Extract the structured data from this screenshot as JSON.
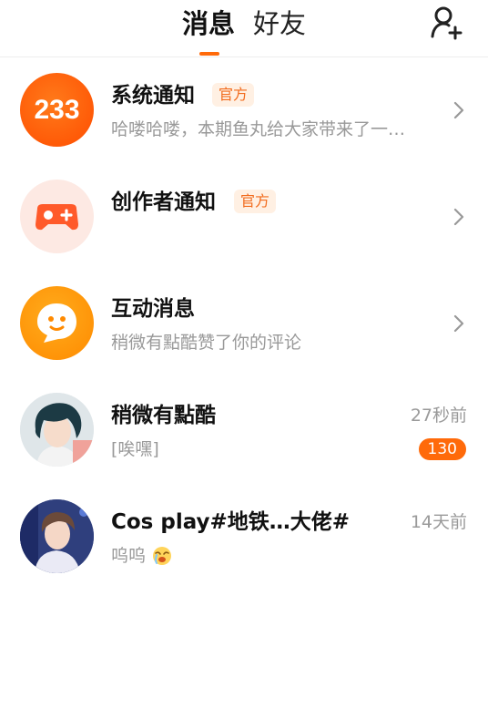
{
  "header": {
    "tabs": [
      {
        "label": "消息",
        "active": true
      },
      {
        "label": "好友",
        "active": false
      }
    ],
    "add_friend_icon": "add-user-icon",
    "accent_color": "#ff6a0a"
  },
  "conversations": [
    {
      "title": "系统通知",
      "badge": "官方",
      "preview": "哈喽哈喽，本期鱼丸给大家带来了一…",
      "avatar_text": "233",
      "avatar_icon": "233-logo-icon",
      "chevron": true
    },
    {
      "title": "创作者通知",
      "badge": "官方",
      "preview": "",
      "avatar_icon": "gamepad-icon",
      "chevron": true
    },
    {
      "title": "互动消息",
      "preview": "稍微有點酷赞了你的评论",
      "avatar_icon": "chat-bubble-icon",
      "chevron": true
    },
    {
      "title": "稍微有點酷",
      "preview": "[唉嘿]",
      "time": "27秒前",
      "unread_count": "130",
      "avatar_icon": "user-avatar"
    },
    {
      "title": "Cos play#地铁…大佬#",
      "preview": "呜呜",
      "preview_emoji": "crying-face-emoji",
      "time": "14天前",
      "avatar_icon": "user-avatar"
    }
  ]
}
